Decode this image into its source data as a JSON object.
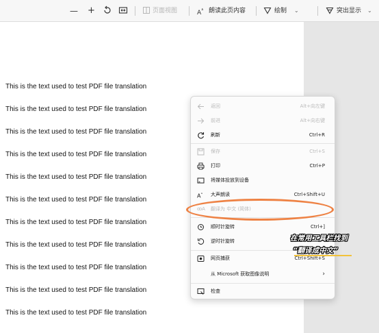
{
  "toolbar": {
    "minus": "—",
    "plus": "+",
    "page_view": "页面视图",
    "read_aloud": "朗读此页内容",
    "draw": "绘制",
    "highlight": "突出显示"
  },
  "document": {
    "lines": [
      "This is the text used to test PDF file translation",
      "This is the text used to test PDF file translation",
      "This is the text used to test PDF file translation",
      "This is the text used to test PDF file translation",
      "This is the text used to test PDF file translation",
      "This is the text used to test PDF file translation",
      "This is the text used to test PDF file translation",
      "This is the text used to test PDF file translation",
      "This is the text used to test PDF file translation",
      "This is the text used to test PDF file translation",
      "This is the text used to test PDF file translation"
    ]
  },
  "context_menu": {
    "items": [
      {
        "label": "返回",
        "shortcut": "Alt+向左键",
        "disabled": true
      },
      {
        "label": "前进",
        "shortcut": "Alt+向右键",
        "disabled": true
      },
      {
        "label": "刷新",
        "shortcut": "Ctrl+R",
        "disabled": false
      },
      {
        "label": "保存",
        "shortcut": "Ctrl+S",
        "disabled": true
      },
      {
        "label": "打印",
        "shortcut": "Ctrl+P",
        "disabled": false
      },
      {
        "label": "将媒体投放到设备",
        "shortcut": "",
        "disabled": false
      },
      {
        "label": "大声朗读",
        "shortcut": "Ctrl+Shift+U",
        "disabled": false
      },
      {
        "label": "翻译为 中文 (简体)",
        "shortcut": "",
        "disabled": true
      },
      {
        "label": "顺时针旋转",
        "shortcut": "Ctrl+]",
        "disabled": false
      },
      {
        "label": "逆时针旋转",
        "shortcut": "",
        "disabled": false
      },
      {
        "label": "网页捕获",
        "shortcut": "Ctrl+Shift+S",
        "disabled": false
      },
      {
        "label": "从 Microsoft 获取图像说明",
        "shortcut": "",
        "submenu_arrow": "›",
        "disabled": false
      },
      {
        "label": "检查",
        "shortcut": "",
        "disabled": false
      }
    ]
  },
  "annotation": {
    "line1": "在常用工具栏找到",
    "line2": "“翻译成中文”"
  },
  "colors": {
    "highlight_ring": "#ee8244",
    "annotation_underline": "#f2c23a"
  }
}
